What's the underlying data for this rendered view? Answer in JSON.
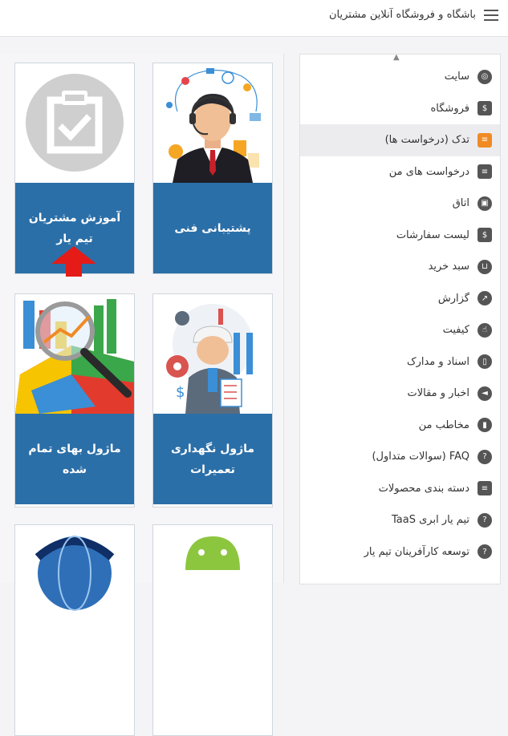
{
  "header": {
    "title": "باشگاه و فروشگاه آنلاین مشتریان"
  },
  "sidebar": {
    "items": [
      {
        "label": "سایت",
        "icon": "globe-icon"
      },
      {
        "label": "فروشگاه",
        "icon": "invoice-icon"
      },
      {
        "label": "تدک (درخواست ها)",
        "icon": "list-icon",
        "active": true
      },
      {
        "label": "درخواست های من",
        "icon": "list-icon"
      },
      {
        "label": "اتاق",
        "icon": "room-icon"
      },
      {
        "label": "لیست سفارشات",
        "icon": "invoice-icon"
      },
      {
        "label": "سبد خرید",
        "icon": "cart-icon"
      },
      {
        "label": "گزارش",
        "icon": "report-icon"
      },
      {
        "label": "کیفیت",
        "icon": "hand-icon"
      },
      {
        "label": "اسناد و مدارک",
        "icon": "documents-icon"
      },
      {
        "label": "اخبار و مقالات",
        "icon": "megaphone-icon"
      },
      {
        "label": "مخاطب من",
        "icon": "chart-icon"
      },
      {
        "label": "FAQ (سوالات متداول)",
        "icon": "question-icon"
      },
      {
        "label": "دسته بندی محصولات",
        "icon": "list-icon"
      },
      {
        "label": "تیم یار ابری TaaS",
        "icon": "question-icon"
      },
      {
        "label": "توسعه کارآفرینان تیم یار",
        "icon": "question-icon"
      }
    ]
  },
  "tiles": {
    "support": {
      "label": "پشتیبانی فنی"
    },
    "training": {
      "label": "آموزش مشتریان تیم یار"
    },
    "maintenance": {
      "label": "ماژول نگهداری تعمیرات"
    },
    "costing": {
      "label": "ماژول بهای تمام شده"
    }
  },
  "colors": {
    "caption": "#2b6fa8",
    "active_item": "#ececef",
    "arrow": "#e41b17",
    "accent": "#f08a24"
  }
}
